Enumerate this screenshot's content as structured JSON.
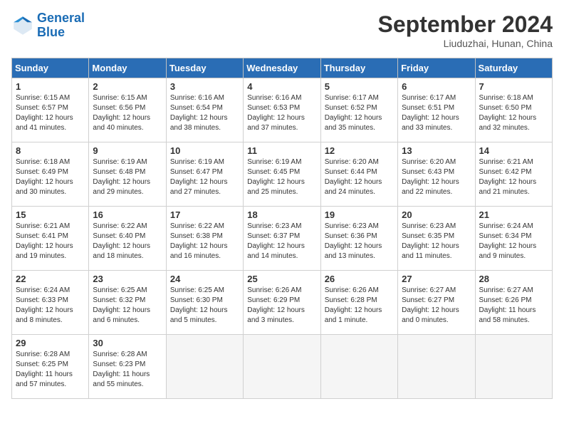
{
  "logo": {
    "line1": "General",
    "line2": "Blue"
  },
  "title": "September 2024",
  "subtitle": "Liuduzhai, Hunan, China",
  "weekdays": [
    "Sunday",
    "Monday",
    "Tuesday",
    "Wednesday",
    "Thursday",
    "Friday",
    "Saturday"
  ],
  "weeks": [
    [
      {
        "day": "1",
        "sunrise": "6:15 AM",
        "sunset": "6:57 PM",
        "daylight": "12 hours and 41 minutes."
      },
      {
        "day": "2",
        "sunrise": "6:15 AM",
        "sunset": "6:56 PM",
        "daylight": "12 hours and 40 minutes."
      },
      {
        "day": "3",
        "sunrise": "6:16 AM",
        "sunset": "6:54 PM",
        "daylight": "12 hours and 38 minutes."
      },
      {
        "day": "4",
        "sunrise": "6:16 AM",
        "sunset": "6:53 PM",
        "daylight": "12 hours and 37 minutes."
      },
      {
        "day": "5",
        "sunrise": "6:17 AM",
        "sunset": "6:52 PM",
        "daylight": "12 hours and 35 minutes."
      },
      {
        "day": "6",
        "sunrise": "6:17 AM",
        "sunset": "6:51 PM",
        "daylight": "12 hours and 33 minutes."
      },
      {
        "day": "7",
        "sunrise": "6:18 AM",
        "sunset": "6:50 PM",
        "daylight": "12 hours and 32 minutes."
      }
    ],
    [
      {
        "day": "8",
        "sunrise": "6:18 AM",
        "sunset": "6:49 PM",
        "daylight": "12 hours and 30 minutes."
      },
      {
        "day": "9",
        "sunrise": "6:19 AM",
        "sunset": "6:48 PM",
        "daylight": "12 hours and 29 minutes."
      },
      {
        "day": "10",
        "sunrise": "6:19 AM",
        "sunset": "6:47 PM",
        "daylight": "12 hours and 27 minutes."
      },
      {
        "day": "11",
        "sunrise": "6:19 AM",
        "sunset": "6:45 PM",
        "daylight": "12 hours and 25 minutes."
      },
      {
        "day": "12",
        "sunrise": "6:20 AM",
        "sunset": "6:44 PM",
        "daylight": "12 hours and 24 minutes."
      },
      {
        "day": "13",
        "sunrise": "6:20 AM",
        "sunset": "6:43 PM",
        "daylight": "12 hours and 22 minutes."
      },
      {
        "day": "14",
        "sunrise": "6:21 AM",
        "sunset": "6:42 PM",
        "daylight": "12 hours and 21 minutes."
      }
    ],
    [
      {
        "day": "15",
        "sunrise": "6:21 AM",
        "sunset": "6:41 PM",
        "daylight": "12 hours and 19 minutes."
      },
      {
        "day": "16",
        "sunrise": "6:22 AM",
        "sunset": "6:40 PM",
        "daylight": "12 hours and 18 minutes."
      },
      {
        "day": "17",
        "sunrise": "6:22 AM",
        "sunset": "6:38 PM",
        "daylight": "12 hours and 16 minutes."
      },
      {
        "day": "18",
        "sunrise": "6:23 AM",
        "sunset": "6:37 PM",
        "daylight": "12 hours and 14 minutes."
      },
      {
        "day": "19",
        "sunrise": "6:23 AM",
        "sunset": "6:36 PM",
        "daylight": "12 hours and 13 minutes."
      },
      {
        "day": "20",
        "sunrise": "6:23 AM",
        "sunset": "6:35 PM",
        "daylight": "12 hours and 11 minutes."
      },
      {
        "day": "21",
        "sunrise": "6:24 AM",
        "sunset": "6:34 PM",
        "daylight": "12 hours and 9 minutes."
      }
    ],
    [
      {
        "day": "22",
        "sunrise": "6:24 AM",
        "sunset": "6:33 PM",
        "daylight": "12 hours and 8 minutes."
      },
      {
        "day": "23",
        "sunrise": "6:25 AM",
        "sunset": "6:32 PM",
        "daylight": "12 hours and 6 minutes."
      },
      {
        "day": "24",
        "sunrise": "6:25 AM",
        "sunset": "6:30 PM",
        "daylight": "12 hours and 5 minutes."
      },
      {
        "day": "25",
        "sunrise": "6:26 AM",
        "sunset": "6:29 PM",
        "daylight": "12 hours and 3 minutes."
      },
      {
        "day": "26",
        "sunrise": "6:26 AM",
        "sunset": "6:28 PM",
        "daylight": "12 hours and 1 minute."
      },
      {
        "day": "27",
        "sunrise": "6:27 AM",
        "sunset": "6:27 PM",
        "daylight": "12 hours and 0 minutes."
      },
      {
        "day": "28",
        "sunrise": "6:27 AM",
        "sunset": "6:26 PM",
        "daylight": "11 hours and 58 minutes."
      }
    ],
    [
      {
        "day": "29",
        "sunrise": "6:28 AM",
        "sunset": "6:25 PM",
        "daylight": "11 hours and 57 minutes."
      },
      {
        "day": "30",
        "sunrise": "6:28 AM",
        "sunset": "6:23 PM",
        "daylight": "11 hours and 55 minutes."
      },
      null,
      null,
      null,
      null,
      null
    ]
  ]
}
